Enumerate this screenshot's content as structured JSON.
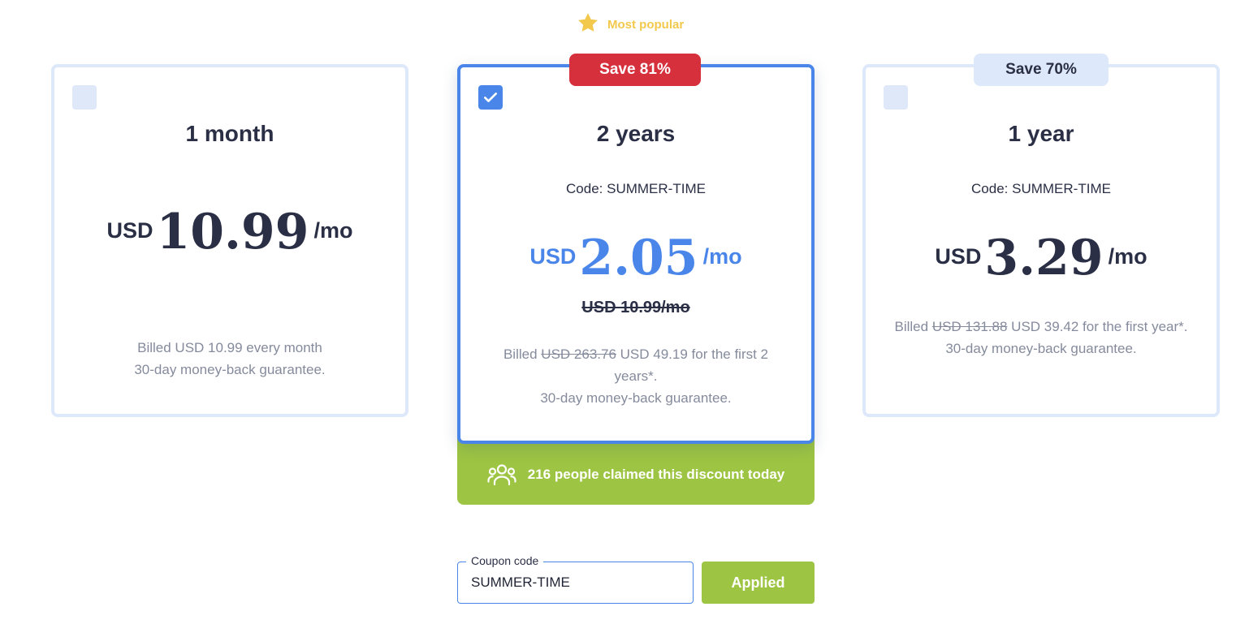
{
  "popular": {
    "icon": "star-icon",
    "label": "Most popular",
    "color": "#f2c94c"
  },
  "plans": {
    "monthly": {
      "checked": false,
      "title": "1 month",
      "currency": "USD",
      "amount": "10.99",
      "period": "/mo",
      "billing_line1": "Billed USD 10.99 every month",
      "billing_line2": "30-day money-back guarantee."
    },
    "two_years": {
      "checked": true,
      "badge": "Save 81%",
      "title": "2 years",
      "code": "Code: SUMMER-TIME",
      "currency": "USD",
      "amount": "2.05",
      "period": "/mo",
      "old_price": "USD 10.99/mo",
      "billing_prefix": "Billed",
      "billing_old": "USD 263.76",
      "billing_rest": "USD 49.19 for the first 2 years*.",
      "guarantee": "30-day money-back guarantee."
    },
    "one_year": {
      "checked": false,
      "badge": "Save 70%",
      "title": "1 year",
      "code": "Code: SUMMER-TIME",
      "currency": "USD",
      "amount": "3.29",
      "period": "/mo",
      "billing_prefix": "Billed",
      "billing_old": "USD 131.88",
      "billing_rest": "USD 39.42 for the first year*.",
      "guarantee": "30-day money-back guarantee."
    }
  },
  "claimed": {
    "icon": "people-icon",
    "text": "216 people claimed this discount today"
  },
  "coupon": {
    "label": "Coupon code",
    "value": "SUMMER-TIME",
    "button_label": "Applied"
  },
  "colors": {
    "accent_blue": "#4a86ea",
    "save_red": "#d5303b",
    "success_green": "#9dc543",
    "card_border": "#dde8fb"
  }
}
